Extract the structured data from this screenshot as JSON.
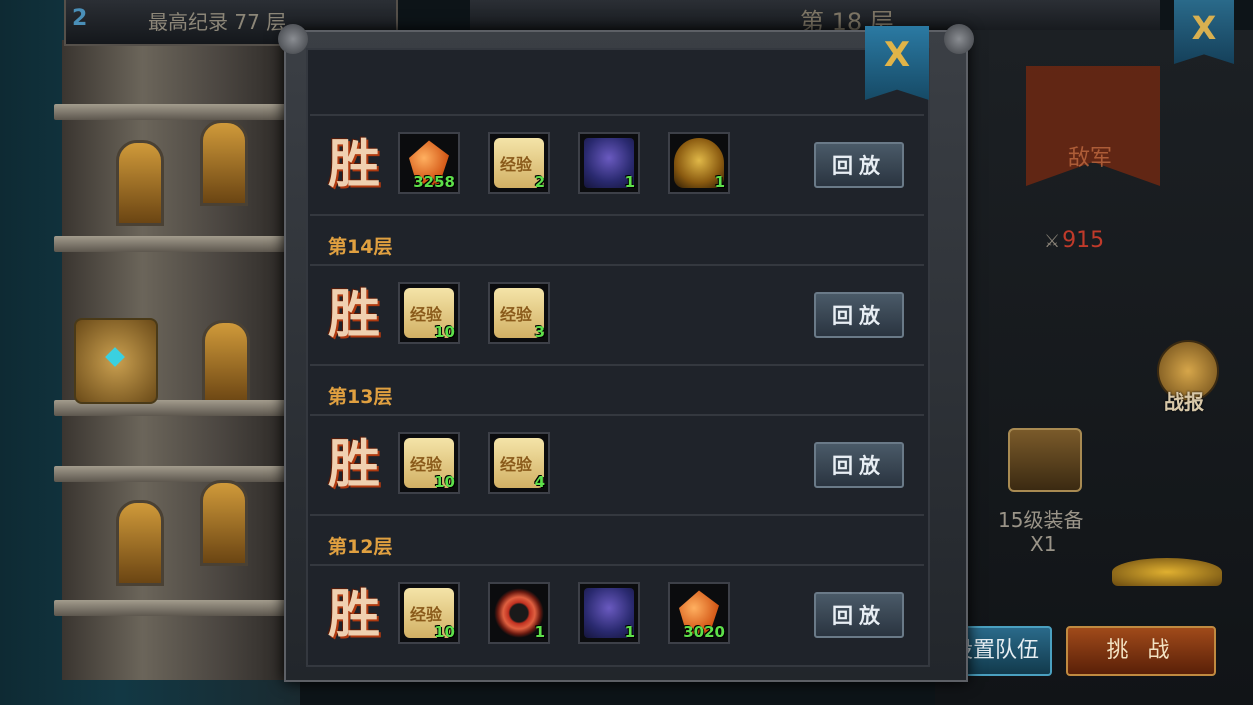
{
  "background": {
    "top_left_num": "2",
    "record_text": "最高纪录 77 层",
    "current_floor": "第 18 层",
    "enemy_banner_text": "敌军",
    "power_value": "915",
    "report_label": "战报",
    "reward_chest_label": "15级装备",
    "reward_chest_qty": "X1",
    "reward_partial": "0",
    "setup_team_label": "设置队伍",
    "challenge_label": "挑 战",
    "close_label": "X"
  },
  "modal": {
    "close_label": "X",
    "victory_text": "胜",
    "replay_label": "回放",
    "entries": [
      {
        "floor": "",
        "items": [
          {
            "icon": "crystal-icon",
            "qty": "3258"
          },
          {
            "icon": "exp-scroll-icon",
            "qty": "2"
          },
          {
            "icon": "armor-icon",
            "qty": "1"
          },
          {
            "icon": "helmet-icon",
            "qty": "1"
          }
        ]
      },
      {
        "floor": "第14层",
        "items": [
          {
            "icon": "exp-scroll-icon",
            "qty": "10"
          },
          {
            "icon": "exp-scroll-icon",
            "qty": "3"
          }
        ]
      },
      {
        "floor": "第13层",
        "items": [
          {
            "icon": "exp-scroll-icon",
            "qty": "10"
          },
          {
            "icon": "exp-scroll-icon",
            "qty": "4"
          }
        ]
      },
      {
        "floor": "第12层",
        "items": [
          {
            "icon": "exp-scroll-icon",
            "qty": "10"
          },
          {
            "icon": "ring-icon",
            "qty": "1"
          },
          {
            "icon": "armor-icon",
            "qty": "1"
          },
          {
            "icon": "crystal-icon",
            "qty": "3020"
          }
        ]
      }
    ],
    "scroll_text": "经验"
  },
  "colors": {
    "floor_label": "#e0a040",
    "qty": "#5ee04a",
    "modal_bg": "#1f232a"
  }
}
